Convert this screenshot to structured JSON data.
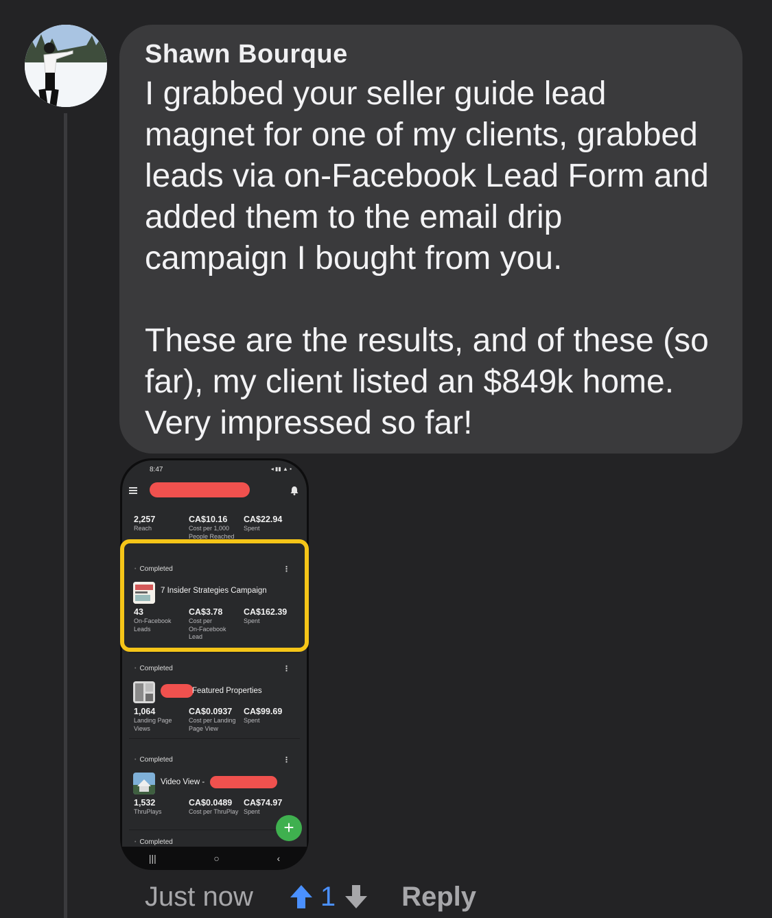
{
  "comment": {
    "author": "Shawn Bourque",
    "text": "I grabbed your seller guide lead\nmagnet for one of my clients, grabbed\nleads via on-Facebook Lead Form and\nadded them to the email drip\ncampaign I bought from you.\n\nThese are the results, and of these (so\nfar), my client listed an $849k home.\nVery impressed so far!",
    "timestamp": "Just now",
    "vote_count": "1",
    "reply_label": "Reply"
  },
  "screenshot": {
    "status_time": "8:47",
    "summary": [
      {
        "value": "2,257",
        "label": "Reach"
      },
      {
        "value": "CA$10.16",
        "label": "Cost per 1,000\nPeople Reached"
      },
      {
        "value": "CA$22.94",
        "label": "Spent"
      }
    ],
    "campaigns": [
      {
        "status": "Completed",
        "name": "7 Insider Strategies Campaign",
        "metrics": [
          {
            "value": "43",
            "label": "On-Facebook\nLeads"
          },
          {
            "value": "CA$3.78",
            "label": "Cost per\nOn-Facebook\nLead"
          },
          {
            "value": "CA$162.39",
            "label": "Spent"
          }
        ]
      },
      {
        "status": "Completed",
        "name": "Featured Properties",
        "metrics": [
          {
            "value": "1,064",
            "label": "Landing Page\nViews"
          },
          {
            "value": "CA$0.0937",
            "label": "Cost per Landing\nPage View"
          },
          {
            "value": "CA$99.69",
            "label": "Spent"
          }
        ]
      },
      {
        "status": "Completed",
        "name": "Video View -",
        "metrics": [
          {
            "value": "1,532",
            "label": "ThruPlays"
          },
          {
            "value": "CA$0.0489",
            "label": "Cost per ThruPlay"
          },
          {
            "value": "CA$74.97",
            "label": "Spent"
          }
        ]
      },
      {
        "status": "Completed"
      }
    ],
    "fab_label": "+"
  },
  "colors": {
    "highlight": "#f5c518",
    "redaction": "#f0514e",
    "upvote": "#4a90ff",
    "fab": "#3fb04f"
  }
}
